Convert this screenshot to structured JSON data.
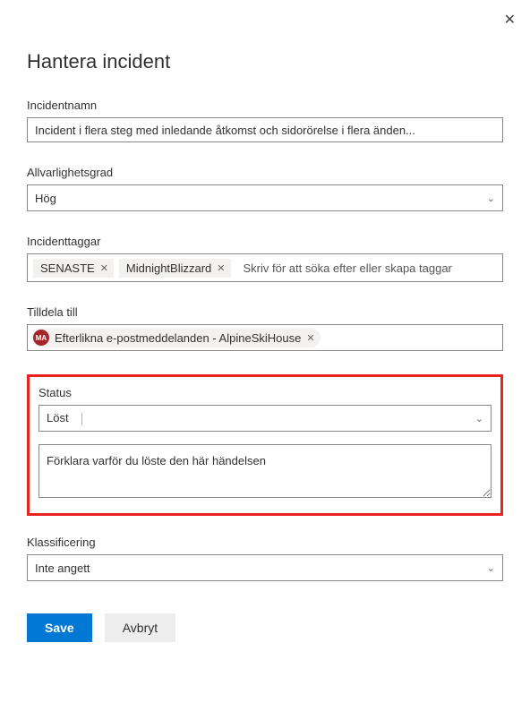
{
  "title": "Hantera incident",
  "fields": {
    "name": {
      "label": "Incidentnamn",
      "value": "Incident i flera steg med inledande åtkomst och sidorörelse i flera änden..."
    },
    "severity": {
      "label": "Allvarlighetsgrad",
      "value": "Hög"
    },
    "tags": {
      "label": "Incidenttaggar",
      "items": [
        "SENASTE",
        "MidnightBlizzard"
      ],
      "placeholder": "Skriv för att söka efter eller skapa taggar"
    },
    "assign": {
      "label": "Tilldela till",
      "avatar": "MA",
      "value": "Efterlikna e-postmeddelanden - AlpineSkiHouse"
    },
    "status": {
      "label": "Status",
      "value": "Löst",
      "reason_placeholder": "Förklara varför du löste den här händelsen"
    },
    "classification": {
      "label": "Klassificering",
      "value": "Inte angett"
    }
  },
  "buttons": {
    "save": "Save",
    "cancel": "Avbryt"
  }
}
